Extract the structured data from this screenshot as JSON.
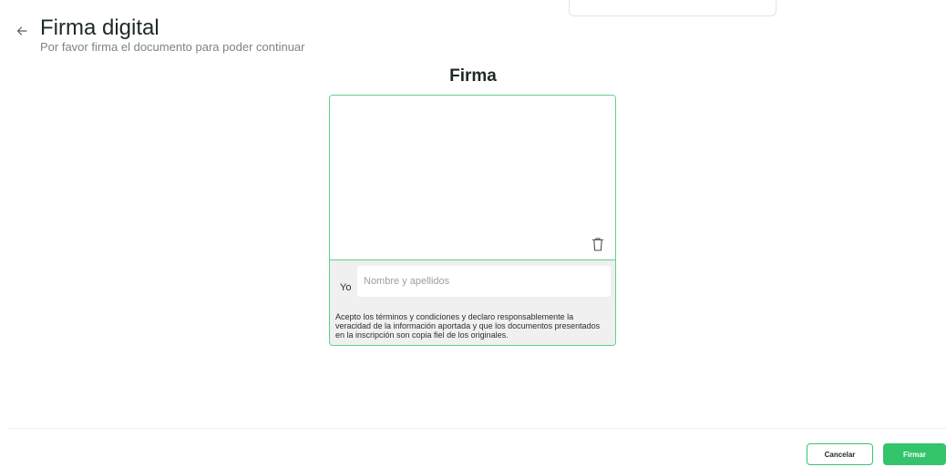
{
  "header": {
    "title": "Firma digital",
    "subtitle": "Por favor firma el documento para poder continuar"
  },
  "signature": {
    "section_title": "Firma",
    "prefix_label": "Yo",
    "name_placeholder": "Nombre y apellidos",
    "name_value": "",
    "terms_text": "Acepto los términos y condiciones y declaro responsablemente la veracidad de la información aportada y que los documentos presentados en la inscripción son copia fiel de los originales."
  },
  "footer": {
    "cancel_label": "Cancelar",
    "sign_label": "Firmar"
  },
  "icons": {
    "back": "arrow-left-icon",
    "clear": "trash-icon"
  },
  "colors": {
    "accent": "#33c46c",
    "card_border": "#5fd08d",
    "card_footer_bg": "#eff0ef"
  }
}
